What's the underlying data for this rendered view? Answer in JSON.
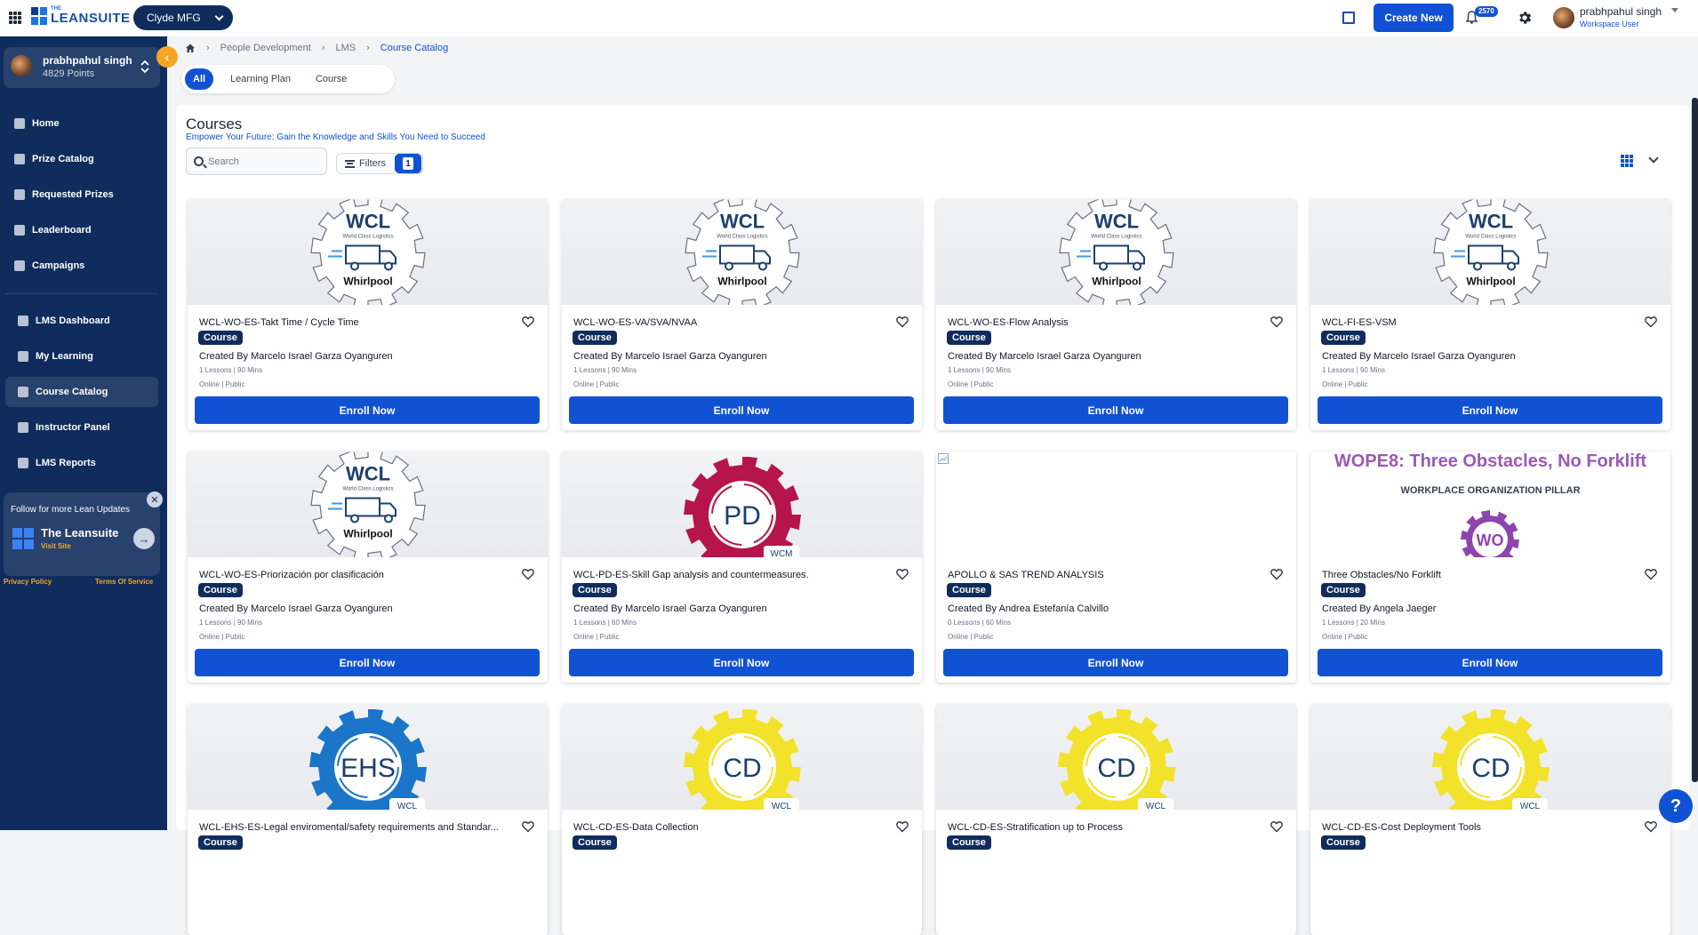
{
  "header": {
    "logo_small": "THE",
    "logo_text": "LEANSUITE",
    "org": "Clyde MFG",
    "create_new": "Create New",
    "notifications": "2570",
    "user_name": "prabhpahul singh",
    "user_role": "Workspace User"
  },
  "sidebar": {
    "profile_name": "prabhpahul singh",
    "profile_points": "4829 Points",
    "items": [
      {
        "label": "Home",
        "icon": "home-icon"
      },
      {
        "label": "Prize Catalog",
        "icon": "prize-icon"
      },
      {
        "label": "Requested Prizes",
        "icon": "requested-icon"
      },
      {
        "label": "Leaderboard",
        "icon": "leaderboard-icon"
      },
      {
        "label": "Campaigns",
        "icon": "campaigns-icon"
      },
      {
        "label": "LMS Dashboard",
        "icon": "dashboard-icon"
      },
      {
        "label": "My Learning",
        "icon": "learning-icon"
      },
      {
        "label": "Course Catalog",
        "icon": "catalog-icon"
      },
      {
        "label": "Instructor Panel",
        "icon": "instructor-icon"
      },
      {
        "label": "LMS Reports",
        "icon": "reports-icon"
      }
    ],
    "follow_title": "Follow for more Lean Updates",
    "follow_brand": "The Leansuite",
    "follow_link": "Visit Site",
    "privacy": "Privacy Policy",
    "terms": "Terms Of Service"
  },
  "breadcrumb": {
    "items": [
      "People Development",
      "LMS"
    ],
    "current": "Course Catalog"
  },
  "tabs": [
    "All",
    "Learning Plan",
    "Course"
  ],
  "panel": {
    "title": "Courses",
    "subtitle": "Empower Your Future: Gain the Knowledge and Skills You Need to Succeed",
    "search_placeholder": "Search",
    "filters_label": "Filters",
    "filter_count": "1"
  },
  "colors": {
    "primary": "#1152d4",
    "navy": "#0f2c5c",
    "accent": "#f5a623"
  },
  "cards": [
    {
      "title": "WCL-WO-ES-Takt Time / Cycle Time",
      "badge": "Course",
      "author": "Created By Marcelo Israel Garza Oyanguren",
      "meta": "1 Lessons | 90 Mins",
      "mode": "Online | Public",
      "enroll": "Enroll Now",
      "image": "wcl",
      "img_title": "WCL",
      "img_sub": "World Class Logistics",
      "img_brand": "Whirlpool"
    },
    {
      "title": "WCL-WO-ES-VA/SVA/NVAA",
      "badge": "Course",
      "author": "Created By Marcelo Israel Garza Oyanguren",
      "meta": "1 Lessons | 90 Mins",
      "mode": "Online | Public",
      "enroll": "Enroll Now",
      "image": "wcl",
      "img_title": "WCL",
      "img_sub": "World Class Logistics",
      "img_brand": "Whirlpool"
    },
    {
      "title": "WCL-WO-ES-Flow Analysis",
      "badge": "Course",
      "author": "Created By Marcelo Israel Garza Oyanguren",
      "meta": "1 Lessons | 90 Mins",
      "mode": "Online | Public",
      "enroll": "Enroll Now",
      "image": "wcl",
      "img_title": "WCL",
      "img_sub": "World Class Logistics",
      "img_brand": "Whirlpool"
    },
    {
      "title": "WCL-FI-ES-VSM",
      "badge": "Course",
      "author": "Created By Marcelo Israel Garza Oyanguren",
      "meta": "1 Lessons | 90 Mins",
      "mode": "Online | Public",
      "enroll": "Enroll Now",
      "image": "wcl",
      "img_title": "WCL",
      "img_sub": "World Class Logistics",
      "img_brand": "Whirlpool"
    },
    {
      "title": "WCL-WO-ES-Priorización por clasificación",
      "badge": "Course",
      "author": "Created By Marcelo Israel Garza Oyanguren",
      "meta": "1 Lessons | 90 Mins",
      "mode": "Online | Public",
      "enroll": "Enroll Now",
      "image": "wcl",
      "img_title": "WCL",
      "img_sub": "World Class Logistics",
      "img_brand": "Whirlpool"
    },
    {
      "title": "WCL-PD-ES-Skill Gap analysis and countermeasures.",
      "badge": "Course",
      "author": "Created By Marcelo Israel Garza Oyanguren",
      "meta": "1 Lessons | 60 Mins",
      "mode": "Online | Public",
      "enroll": "Enroll Now",
      "image": "gear",
      "gear_color": "#b5154b",
      "img_title": "PD",
      "img_tag": "WCM"
    },
    {
      "title": "APOLLO & SAS TREND ANALYSIS",
      "badge": "Course",
      "author": "Created By Andrea Estefanía Calvillo",
      "meta": "0 Lessons | 60 Mins",
      "mode": "Online | Public",
      "enroll": "Enroll Now",
      "image": "blank"
    },
    {
      "title": "Three Obstacles/No Forklift",
      "badge": "Course",
      "author": "Created By Angela Jaeger",
      "meta": "1 Lessons | 20 Mins",
      "mode": "Online | Public",
      "enroll": "Enroll Now",
      "image": "wope",
      "img_top": "WOPE8: Three Obstacles, No Forklift",
      "img_pillar": "WORKPLACE ORGANIZATION PILLAR",
      "img_title": "WO"
    },
    {
      "title": "WCL-EHS-ES-Legal enviromental/safety requirements and Standar...",
      "badge": "Course",
      "author": "",
      "meta": "",
      "mode": "",
      "enroll": "Enroll Now",
      "image": "gear",
      "gear_color": "#1b75c9",
      "img_title": "EHS",
      "img_tag": "WCL"
    },
    {
      "title": "WCL-CD-ES-Data Collection",
      "badge": "Course",
      "author": "",
      "meta": "",
      "mode": "",
      "enroll": "Enroll Now",
      "image": "gear",
      "gear_color": "#f2e22a",
      "img_title": "CD",
      "img_tag": "WCL"
    },
    {
      "title": "WCL-CD-ES-Stratification up to Process",
      "badge": "Course",
      "author": "",
      "meta": "",
      "mode": "",
      "enroll": "Enroll Now",
      "image": "gear",
      "gear_color": "#f2e22a",
      "img_title": "CD",
      "img_tag": "WCL"
    },
    {
      "title": "WCL-CD-ES-Cost Deployment Tools",
      "badge": "Course",
      "author": "",
      "meta": "",
      "mode": "",
      "enroll": "Enroll Now",
      "image": "gear",
      "gear_color": "#f2e22a",
      "img_title": "CD",
      "img_tag": "WCL"
    }
  ],
  "help": "?"
}
